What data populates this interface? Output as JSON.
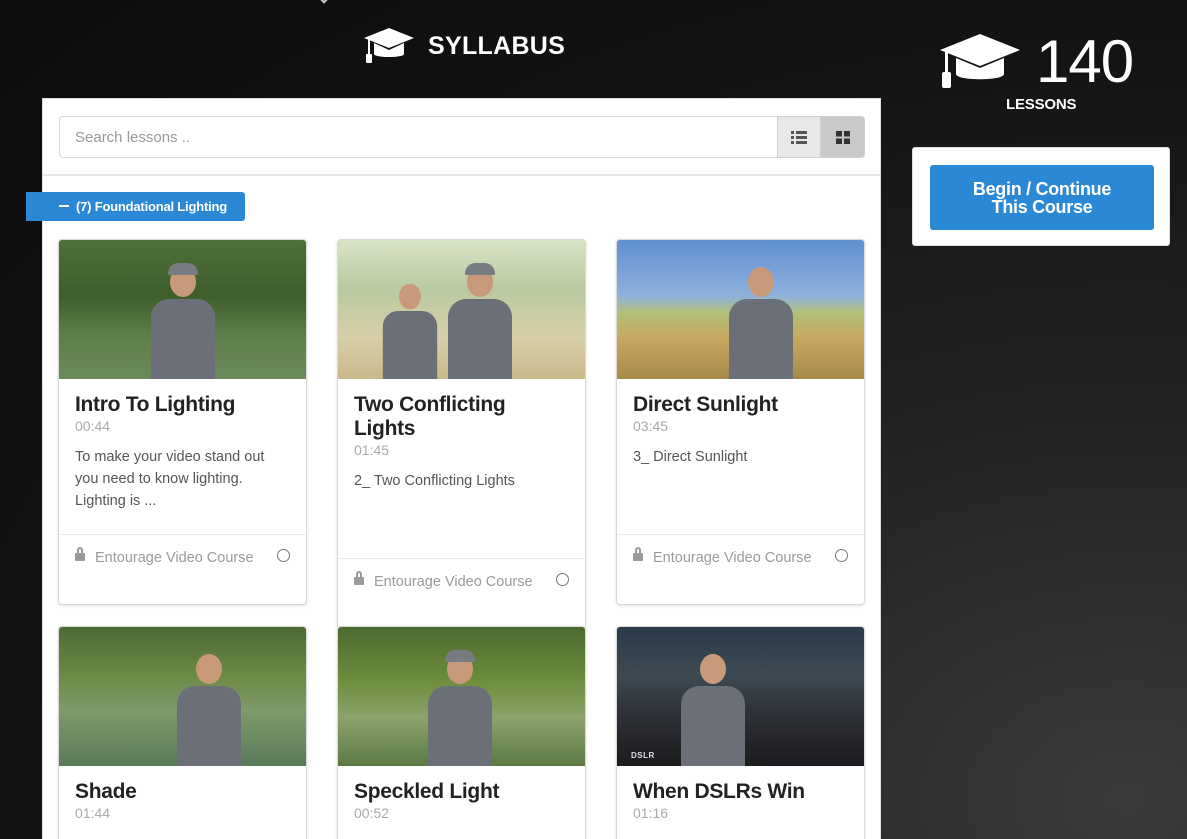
{
  "header": {
    "title": "SYLLABUS"
  },
  "stats": {
    "lesson_count": "140",
    "lesson_label": "LESSONS"
  },
  "cta": {
    "line1": "Begin / Continue",
    "line2": "This Course"
  },
  "search": {
    "placeholder": "Search lessons .."
  },
  "section": {
    "label": "(7) Foundational Lighting"
  },
  "lessons": [
    {
      "title": "Intro To Lighting",
      "duration": "00:44",
      "description": "To make your video stand out you need to know lighting. Lighting is ...",
      "course": "Entourage Video Course"
    },
    {
      "title": "Two Conflicting Lights",
      "duration": "01:45",
      "description": "2_ Two Conflicting Lights",
      "course": "Entourage Video Course"
    },
    {
      "title": "Direct Sunlight",
      "duration": "03:45",
      "description": "3_ Direct Sunlight",
      "course": "Entourage Video Course"
    },
    {
      "title": "Shade",
      "duration": "01:44",
      "description": "",
      "course": ""
    },
    {
      "title": "Speckled Light",
      "duration": "00:52",
      "description": "",
      "course": ""
    },
    {
      "title": "When DSLRs Win",
      "duration": "01:16",
      "description": "",
      "course": "",
      "thumb_tag": "DSLR"
    }
  ],
  "colors": {
    "accent": "#2a88d4",
    "background": "#111111",
    "panel": "#ffffff"
  },
  "icons": {
    "header": "graduation-cap-icon",
    "stats": "graduation-cap-icon",
    "list_view": "list-view-icon",
    "grid_view": "grid-view-icon",
    "lock": "lock-icon",
    "section": "minus-icon"
  }
}
